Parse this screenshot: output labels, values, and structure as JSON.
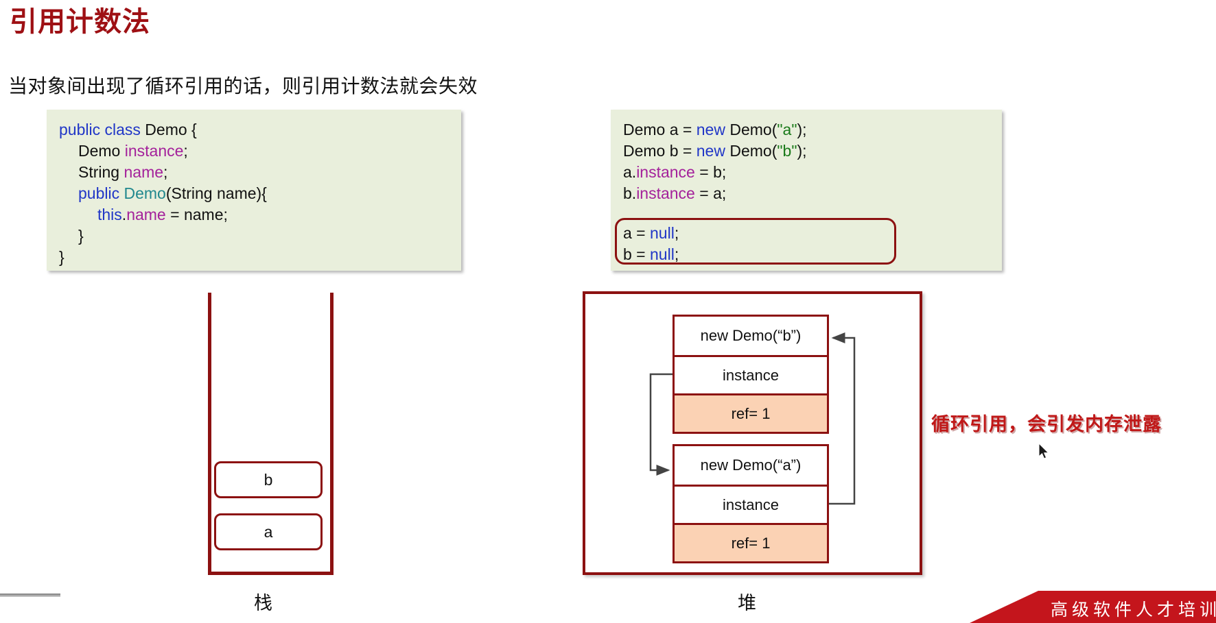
{
  "slide": {
    "title": "引用计数法",
    "subtitle": "当对象间出现了循环引用的话，则引用计数法就会失效",
    "note": "循环引用，会引发内存泄露",
    "bottom_ribbon": "高级软件人才培训专家"
  },
  "colors": {
    "title_red": "#9E1014",
    "note_red": "#C01818",
    "border_red": "#8C1111",
    "code_bg": "#E9EFDC",
    "ref_bg": "#FBD2B4",
    "keyword_blue": "#2036C7",
    "field_purple": "#A4219B",
    "class_teal": "#21888E",
    "string_green": "#1A7A1A",
    "ribbon_red": "#C4151C"
  },
  "code_left": {
    "lines": [
      "public class Demo {",
      "   Demo instance;",
      "   String name;",
      "   public Demo(String name){",
      "      this.name = name;",
      "   }",
      "}"
    ],
    "tokens": {
      "public": "public",
      "class": "class",
      "demo": "Demo",
      "brace_open": "{",
      "instance": "instance",
      "string_type": "String",
      "name": "name",
      "ctor_sig": "(String name){",
      "this": "this",
      "dot": ".",
      "assign_name": " = name;",
      "semicolon": ";",
      "brace_close": "}"
    }
  },
  "code_right": {
    "lines": [
      "Demo a = new Demo(\"a\");",
      "Demo b = new Demo(\"b\");",
      "a.instance = b;",
      "b.instance = a;"
    ],
    "highlighted_lines": [
      "a = null;",
      "b = null;"
    ],
    "tokens": {
      "demo": "Demo",
      "new": "new",
      "null": "null",
      "instance": "instance",
      "str_a": "\"a\"",
      "str_b": "\"b\""
    }
  },
  "stack": {
    "caption": "栈",
    "cells": [
      {
        "label": "b"
      },
      {
        "label": "a"
      }
    ]
  },
  "heap": {
    "caption": "堆",
    "objects": [
      {
        "id": "b",
        "header": "new Demo(“b”)",
        "field": "instance",
        "ref": "ref= 1"
      },
      {
        "id": "a",
        "header": "new Demo(“a”)",
        "field": "instance",
        "ref": "ref= 1"
      }
    ]
  }
}
